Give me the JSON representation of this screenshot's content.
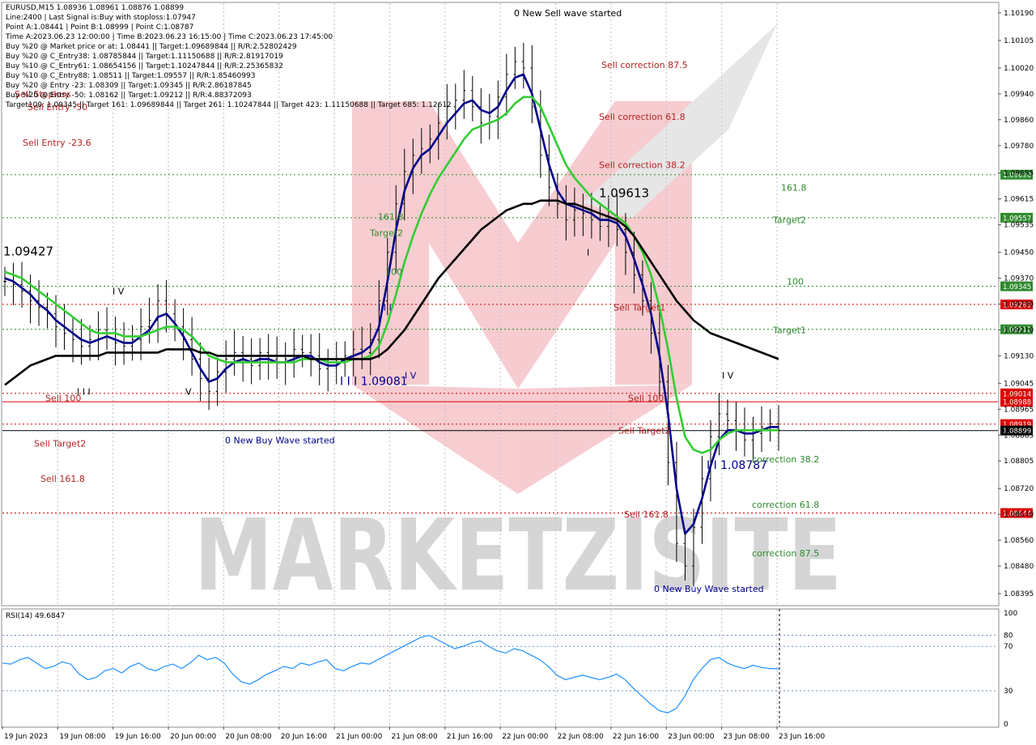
{
  "header": {
    "lines": [
      "EURUSD,M15  1.08936 1.08961 1.08876 1.08899",
      "Line:2400 | Last Signal is:Buy with stoploss:1.07947",
      "Point A:1.08441 | Point B:1.08999 | Point C:1.08787",
      "Time A:2023.06.23 12:00:00 | Time B:2023.06.23 16:15:00 | Time C:2023.06.23 17:45:00",
      "Buy %20 @ Market price or at: 1.08441 || Target:1.09689844 || R/R:2.52802429",
      "Buy %20 @ C_Entry38: 1.08785844 || Target:1.11150688 || R/R:2.81917019",
      "Buy %10 @ C_Entry61: 1.08654156 || Target:1.10247844 || R/R:2.25365832",
      "Buy %10 @ C_Entry88: 1.08511 || Target:1.09557 || R/R:1.85460993",
      "Buy %20 @ Entry -23: 1.08309 || Target:1.09345 || R/R:2.86187845",
      "Buy %20 @ Entry -50: 1.08162 || Target:1.09212 || R/R:4.88372093",
      "Target100: 1.09345 || Target 161: 1.09689844 || Target 261: 1.10247844 || Target 423: 1.11150688 || Target 685: 1.12612"
    ]
  },
  "watermark": {
    "text": "MARKETZISITE"
  },
  "colors": {
    "price_bar": "#000000",
    "ma_fast": "#00008b",
    "ma_mid": "#32cd32",
    "ma_slow": "#000000",
    "level_green": "#2e8b2e",
    "level_red": "#b22222",
    "rsi_line": "#1e90ff",
    "label_green_bg": "#2e8b2e",
    "label_red_bg": "#dd0000",
    "label_black_bg": "#000000"
  },
  "chart_data": [
    {
      "type": "candlestick",
      "symbol": "EURUSD",
      "timeframe": "M15",
      "ylim": [
        1.0836,
        1.1022
      ],
      "price_ticks": [
        "1.10190",
        "1.10105",
        "1.10020",
        "1.09940",
        "1.09860",
        "1.09780",
        "1.09695",
        "1.09615",
        "1.09535",
        "1.09450",
        "1.09370",
        "1.09290",
        "1.09210",
        "1.09130",
        "1.09045",
        "1.08965",
        "1.08885",
        "1.08805",
        "1.08720",
        "1.08640",
        "1.08560",
        "1.08480",
        "1.08395"
      ],
      "time_labels": [
        "19 Jun 2023",
        "19 Jun 08:00",
        "19 Jun 16:00",
        "20 Jun 00:00",
        "20 Jun 08:00",
        "20 Jun 16:00",
        "21 Jun 00:00",
        "21 Jun 08:00",
        "21 Jun 16:00",
        "22 Jun 00:00",
        "22 Jun 08:00",
        "22 Jun 16:00",
        "23 Jun 00:00",
        "23 Jun 08:00",
        "23 Jun 16:00"
      ],
      "close_series": [
        1.0936,
        1.0935,
        1.0933,
        1.093,
        1.0928,
        1.0926,
        1.0922,
        1.092,
        1.0918,
        1.0916,
        1.0918,
        1.0921,
        1.092,
        1.0917,
        1.0916,
        1.0918,
        1.0922,
        1.0924,
        1.093,
        1.0926,
        1.0922,
        1.0918,
        1.0912,
        1.0906,
        1.0902,
        1.0908,
        1.0912,
        1.0914,
        1.0912,
        1.091,
        1.0914,
        1.0912,
        1.0911,
        1.0912,
        1.0915,
        1.0914,
        1.0913,
        1.0909,
        1.091,
        1.0911,
        1.0913,
        1.0915,
        1.0914,
        1.0918,
        1.093,
        1.0945,
        1.096,
        1.097,
        1.0975,
        1.0977,
        1.098,
        1.0985,
        1.099,
        1.0992,
        1.0995,
        1.099,
        1.0985,
        1.0987,
        1.0993,
        1.1,
        1.1004,
        1.1002,
        1.099,
        1.0975,
        1.0965,
        1.096,
        1.0955,
        1.0958,
        1.0957,
        1.0955,
        1.0953,
        1.0956,
        1.0952,
        1.0945,
        1.0938,
        1.093,
        1.092,
        1.0905,
        1.088,
        1.0855,
        1.0848,
        1.086,
        1.0875,
        1.0888,
        1.0895,
        1.0893,
        1.089,
        1.0887,
        1.0889,
        1.0891,
        1.0892,
        1.089
      ],
      "moving_averages": [
        {
          "name": "fast",
          "color": "#00008b",
          "values": [
            1.0937,
            1.0936,
            1.0934,
            1.0932,
            1.0929,
            1.0927,
            1.0924,
            1.0922,
            1.092,
            1.0918,
            1.0917,
            1.0918,
            1.0919,
            1.0918,
            1.0917,
            1.0917,
            1.0919,
            1.0921,
            1.0925,
            1.0926,
            1.0923,
            1.0919,
            1.0914,
            1.0909,
            1.0905,
            1.0906,
            1.0909,
            1.0911,
            1.0912,
            1.0911,
            1.0912,
            1.0912,
            1.0911,
            1.0911,
            1.0912,
            1.0913,
            1.0913,
            1.0911,
            1.091,
            1.091,
            1.0912,
            1.0913,
            1.0914,
            1.0916,
            1.0922,
            1.0936,
            1.0952,
            1.0964,
            1.0971,
            1.0975,
            1.0977,
            1.0981,
            1.0985,
            1.0988,
            1.0991,
            1.0992,
            1.0989,
            1.0988,
            1.099,
            1.0995,
            1.0999,
            1.1,
            1.0994,
            1.0983,
            1.0972,
            1.0964,
            1.096,
            1.0959,
            1.0958,
            1.0957,
            1.0955,
            1.0955,
            1.0954,
            1.095,
            1.0943,
            1.0935,
            1.0926,
            1.0913,
            1.0895,
            1.0872,
            1.0858,
            1.0861,
            1.0869,
            1.0879,
            1.0887,
            1.089,
            1.089,
            1.0889,
            1.0889,
            1.089,
            1.0891,
            1.0891
          ]
        },
        {
          "name": "mid",
          "color": "#32cd32",
          "values": [
            1.0939,
            1.0938,
            1.0937,
            1.0935,
            1.0933,
            1.0931,
            1.0929,
            1.0927,
            1.0925,
            1.0923,
            1.0921,
            1.092,
            1.092,
            1.092,
            1.0919,
            1.0919,
            1.0919,
            1.092,
            1.0921,
            1.0922,
            1.0922,
            1.0921,
            1.0919,
            1.0916,
            1.0913,
            1.0912,
            1.0911,
            1.0911,
            1.0911,
            1.0911,
            1.0911,
            1.0911,
            1.0911,
            1.0911,
            1.0911,
            1.0912,
            1.0912,
            1.0912,
            1.0911,
            1.0911,
            1.0911,
            1.0912,
            1.0912,
            1.0913,
            1.0916,
            1.0923,
            1.0932,
            1.0942,
            1.095,
            1.0957,
            1.0963,
            1.0968,
            1.0972,
            1.0976,
            1.098,
            1.0983,
            1.0984,
            1.0985,
            1.0986,
            1.0988,
            1.0991,
            1.0993,
            1.0993,
            1.099,
            1.0984,
            1.0978,
            1.0972,
            1.0968,
            1.0965,
            1.0962,
            1.096,
            1.0958,
            1.0956,
            1.0954,
            1.095,
            1.0945,
            1.0938,
            1.0928,
            1.0915,
            1.09,
            1.0888,
            1.0884,
            1.0883,
            1.0884,
            1.0887,
            1.0889,
            1.089,
            1.089,
            1.089,
            1.089,
            1.089,
            1.089
          ]
        },
        {
          "name": "slow",
          "color": "#000000",
          "values": [
            1.0904,
            1.0906,
            1.0908,
            1.091,
            1.0911,
            1.0912,
            1.0913,
            1.0913,
            1.0913,
            1.0913,
            1.0913,
            1.0913,
            1.0914,
            1.0914,
            1.0914,
            1.0914,
            1.0914,
            1.0914,
            1.0914,
            1.0915,
            1.0915,
            1.0915,
            1.0915,
            1.0914,
            1.0914,
            1.0913,
            1.0913,
            1.0913,
            1.0913,
            1.0913,
            1.0913,
            1.0913,
            1.0913,
            1.0913,
            1.0913,
            1.0913,
            1.0912,
            1.0912,
            1.0912,
            1.0912,
            1.0912,
            1.0912,
            1.0912,
            1.0912,
            1.0913,
            1.0915,
            1.0918,
            1.0921,
            1.0925,
            1.0929,
            1.0933,
            1.0937,
            1.094,
            1.0943,
            1.0946,
            1.0949,
            1.0952,
            1.0954,
            1.0956,
            1.0958,
            1.0959,
            1.096,
            1.096,
            1.0961,
            1.0961,
            1.0961,
            1.096,
            1.096,
            1.0959,
            1.0958,
            1.0957,
            1.0956,
            1.0955,
            1.0953,
            1.095,
            1.0946,
            1.0942,
            1.0938,
            1.0934,
            1.093,
            1.0927,
            1.0924,
            1.0922,
            1.092,
            1.0919,
            1.0918,
            1.0917,
            1.0916,
            1.0915,
            1.0914,
            1.0913,
            1.0912
          ]
        }
      ],
      "horizontal_levels": [
        {
          "price": 1.0969,
          "label": "1.09690",
          "color": "#2e8b2e",
          "style": "dotted"
        },
        {
          "price": 1.09557,
          "label": "1.09557",
          "color": "#2e8b2e",
          "style": "dotted"
        },
        {
          "price": 1.09345,
          "label": "1.09345",
          "color": "#2e8b2e",
          "style": "dotted"
        },
        {
          "price": 1.09289,
          "label": "1.09289",
          "color": "#dd0000",
          "style": "dotted"
        },
        {
          "price": 1.09212,
          "label": "1.09212",
          "color": "#2e8b2e",
          "style": "dotted"
        },
        {
          "price": 1.09014,
          "label": "1.09014",
          "color": "#dd0000",
          "style": "dotted"
        },
        {
          "price": 1.08988,
          "label": "1.08988",
          "color": "#dd0000",
          "style": "solid"
        },
        {
          "price": 1.08919,
          "label": "1.08919",
          "color": "#dd0000",
          "style": "dotted"
        },
        {
          "price": 1.08899,
          "label": "1.08899",
          "color": "#000000",
          "style": "solid"
        },
        {
          "price": 1.08644,
          "label": "1.08644",
          "color": "#dd0000",
          "style": "dotted"
        }
      ],
      "annotations": [
        {
          "text": "0 New Sell wave started",
          "color": "#000000",
          "anchor_price": 1.1018
        },
        {
          "text": "Sell correction 87.5",
          "color": "#b22222",
          "anchor_price": 1.1002
        },
        {
          "text": "Sell correction 61.8",
          "color": "#b22222",
          "anchor_price": 1.0986
        },
        {
          "text": "Sell correction 38.2",
          "color": "#b22222",
          "anchor_price": 1.0971
        },
        {
          "text": "1.09613",
          "color": "#000000",
          "anchor_price": 1.0962
        },
        {
          "text": "161.8",
          "color": "#2e8b2e",
          "anchor_price": 1.0964
        },
        {
          "text": "Target2",
          "color": "#2e8b2e",
          "anchor_price": 1.0954
        },
        {
          "text": "161.8",
          "color": "#2e8b2e",
          "anchor_price": 1.0955
        },
        {
          "text": "Target2",
          "color": "#2e8b2e",
          "anchor_price": 1.095
        },
        {
          "text": "100",
          "color": "#2e8b2e",
          "anchor_price": 1.0938
        },
        {
          "text": "100",
          "color": "#2e8b2e",
          "anchor_price": 1.0935
        },
        {
          "text": "Target1",
          "color": "#2e8b2e",
          "anchor_price": 1.092
        },
        {
          "text": "Sell Target1",
          "color": "#b22222",
          "anchor_price": 1.0927
        },
        {
          "text": "1.09427",
          "color": "#000000",
          "anchor_price": 1.0944
        },
        {
          "text": "Sell Entry -23.6",
          "color": "#b22222",
          "anchor_price": 1.0978
        },
        {
          "text": "Sell Entry -50",
          "color": "#b22222",
          "anchor_price": 1.0989
        },
        {
          "text": "Sell Stoploss",
          "color": "#b22222",
          "anchor_price": 1.0993
        },
        {
          "text": "Sell 100",
          "color": "#b22222",
          "anchor_price": 1.0899
        },
        {
          "text": "Sell 100",
          "color": "#b22222",
          "anchor_price": 1.0899
        },
        {
          "text": "Sell Target2",
          "color": "#b22222",
          "anchor_price": 1.0885
        },
        {
          "text": "Sell Target2",
          "color": "#b22222",
          "anchor_price": 1.0889
        },
        {
          "text": "Sell 161.8",
          "color": "#b22222",
          "anchor_price": 1.0874
        },
        {
          "text": "Sell 161.8",
          "color": "#b22222",
          "anchor_price": 1.0863
        },
        {
          "text": "0 New Buy Wave started",
          "color": "#00008b",
          "anchor_price": 1.0886
        },
        {
          "text": "I I I 1.09081",
          "color": "#00008b",
          "anchor_price": 1.0904
        },
        {
          "text": "I I 1.08787",
          "color": "#00008b",
          "anchor_price": 1.0878
        },
        {
          "text": "correction 38.2",
          "color": "#2e8b2e",
          "anchor_price": 1.088
        },
        {
          "text": "correction 61.8",
          "color": "#2e8b2e",
          "anchor_price": 1.0866
        },
        {
          "text": "correction 87.5",
          "color": "#2e8b2e",
          "anchor_price": 1.0851
        },
        {
          "text": "0 New Buy Wave started",
          "color": "#00008b",
          "anchor_price": 1.084
        },
        {
          "text": "I V",
          "color": "#000000",
          "anchor_price": 1.0932
        },
        {
          "text": "I V",
          "color": "#000000",
          "anchor_price": 1.0906
        },
        {
          "text": "I V",
          "color": "#00008b",
          "anchor_price": 1.0906
        },
        {
          "text": "V",
          "color": "#000000",
          "anchor_price": 1.0901
        },
        {
          "text": "I I I",
          "color": "#000000",
          "anchor_price": 1.0901
        },
        {
          "text": "I I I",
          "color": "#00008b",
          "anchor_price": 1.0927
        },
        {
          "text": "I",
          "color": "#000000",
          "anchor_price": 1.0944
        }
      ]
    },
    {
      "type": "line",
      "title": "RSI(14) 49.6847",
      "ylim": [
        0,
        100
      ],
      "y_ticks": [
        "100",
        "80",
        "70",
        "30",
        "0"
      ],
      "reference_levels": [
        80,
        70,
        30
      ],
      "values": [
        55,
        54,
        58,
        60,
        55,
        50,
        52,
        56,
        54,
        45,
        40,
        42,
        48,
        50,
        46,
        52,
        55,
        50,
        48,
        52,
        54,
        50,
        55,
        62,
        58,
        60,
        55,
        45,
        38,
        36,
        40,
        45,
        48,
        52,
        50,
        55,
        53,
        56,
        58,
        50,
        48,
        52,
        55,
        54,
        58,
        62,
        66,
        70,
        74,
        78,
        80,
        76,
        72,
        68,
        70,
        73,
        75,
        70,
        66,
        64,
        68,
        66,
        62,
        58,
        52,
        44,
        40,
        42,
        44,
        42,
        40,
        42,
        45,
        40,
        32,
        25,
        18,
        12,
        10,
        14,
        25,
        40,
        50,
        58,
        60,
        55,
        52,
        50,
        53,
        51,
        50,
        49.7
      ]
    }
  ]
}
